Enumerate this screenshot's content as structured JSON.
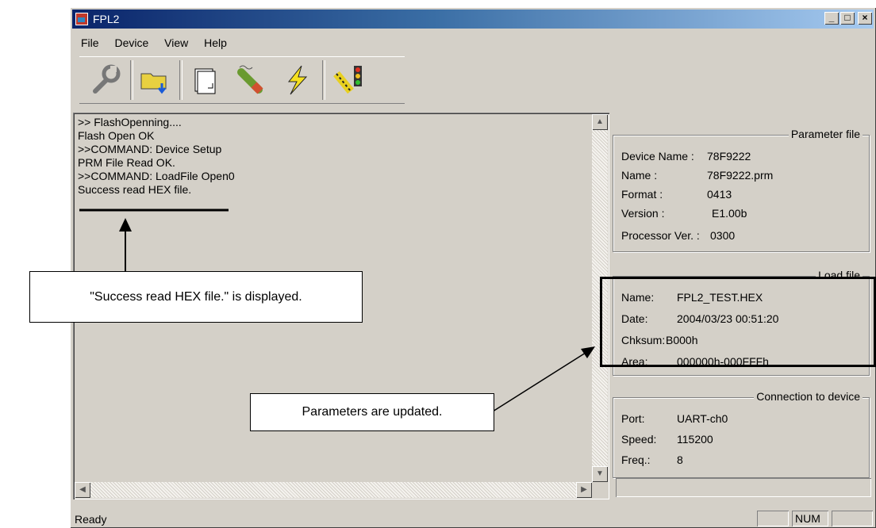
{
  "window": {
    "title": "FPL2",
    "controls": {
      "minimize": "_",
      "maximize": "□",
      "close": "×"
    }
  },
  "menu": {
    "items": [
      "File",
      "Device",
      "View",
      "Help"
    ]
  },
  "toolbar": {
    "icons": [
      "wrench-icon",
      "open-folder-icon",
      "blank-page-icon",
      "eraser-pen-icon",
      "lightning-icon",
      "run-signal-icon"
    ]
  },
  "log": {
    "lines": [
      ">> FlashOpenning....",
      "Flash Open OK",
      ">>COMMAND: Device Setup",
      "PRM File Read OK.",
      ">>COMMAND: LoadFile Open0",
      "Success read HEX file."
    ]
  },
  "parameter_file": {
    "title": "Parameter file",
    "rows": [
      {
        "label": "Device Name :",
        "value": "78F9222"
      },
      {
        "label": "Name :",
        "value": "78F9222.prm"
      },
      {
        "label": "Format :",
        "value": "0413"
      },
      {
        "label": "Version :",
        "value": "E1.00b"
      },
      {
        "label": "Processor Ver. :",
        "value": "0300"
      }
    ]
  },
  "load_file": {
    "title": "Load file",
    "rows": [
      {
        "label": "Name:",
        "value": "FPL2_TEST.HEX"
      },
      {
        "label": "Date:",
        "value": "2004/03/23 00:51:20"
      },
      {
        "label": "Chksum:",
        "value": "B000h"
      },
      {
        "label": "Area:",
        "value": "000000h-000FFFh"
      }
    ]
  },
  "connection": {
    "title": "Connection to device",
    "rows": [
      {
        "label": "Port:",
        "value": "UART-ch0"
      },
      {
        "label": "Speed:",
        "value": "115200"
      },
      {
        "label": "Freq.:",
        "value": "8"
      }
    ]
  },
  "status": {
    "text": "Ready",
    "num": "NUM"
  },
  "annotations": {
    "hex_callout": "\"Success read HEX file.\" is displayed.",
    "params_callout": "Parameters are updated."
  }
}
